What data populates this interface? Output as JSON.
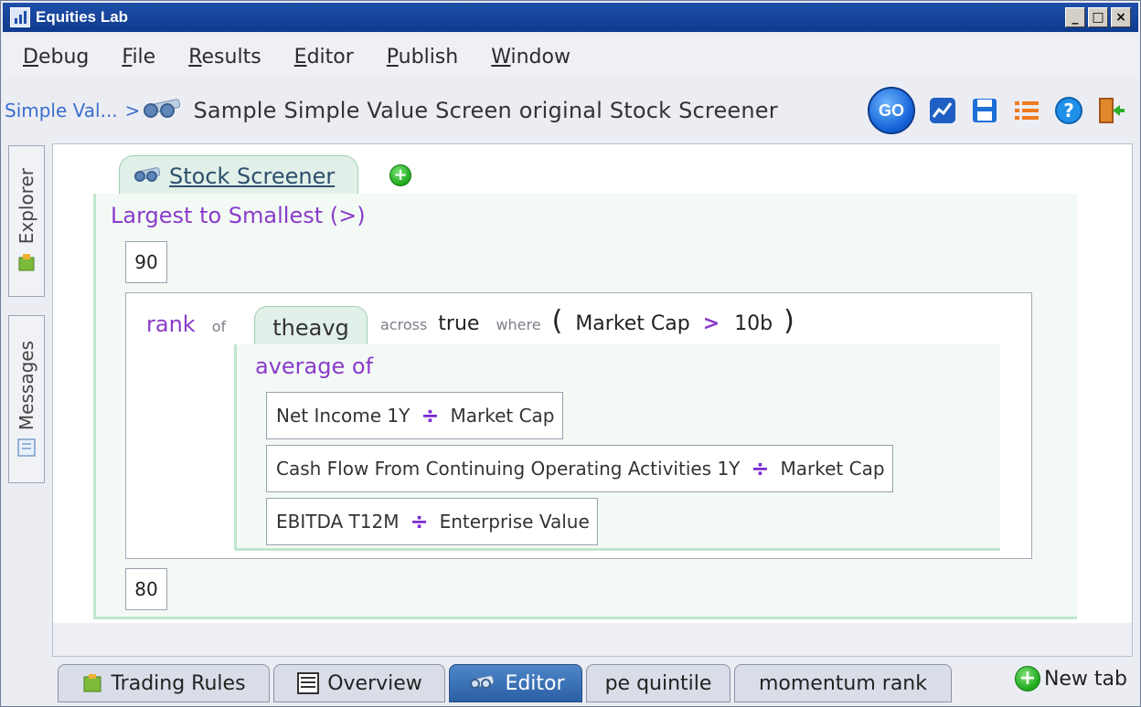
{
  "window": {
    "title": "Equities Lab"
  },
  "window_controls": {
    "minimize": "_",
    "maximize": "□",
    "close": "×"
  },
  "menu": [
    {
      "mnemonic": "D",
      "rest": "ebug"
    },
    {
      "mnemonic": "F",
      "rest": "ile"
    },
    {
      "mnemonic": "R",
      "rest": "esults"
    },
    {
      "mnemonic": "E",
      "rest": "ditor"
    },
    {
      "mnemonic": "P",
      "rest": "ublish"
    },
    {
      "mnemonic": "W",
      "rest": "indow"
    }
  ],
  "breadcrumb": {
    "parent": "Simple Val...",
    "separator": ">",
    "current": "Sample Simple Value Screen original Stock Screener"
  },
  "toolbar": {
    "go_label": "GO",
    "icons": [
      "chart-icon",
      "save-icon",
      "list-icon",
      "help-icon",
      "exit-icon"
    ]
  },
  "dock": {
    "explorer": "Explorer",
    "messages": "Messages"
  },
  "editor": {
    "tab_label": "Stock Screener",
    "heading": "Largest to Smallest (>)",
    "upper_value": "90",
    "lower_value": "80",
    "rank": {
      "keyword": "rank",
      "of": "of",
      "variable": "theavg",
      "across": "across",
      "across_value": "true",
      "where": "where",
      "open_paren": "(",
      "close_paren": ")",
      "condition_field": "Market Cap",
      "condition_op": ">",
      "condition_value": "10b"
    },
    "average": {
      "heading": "average of",
      "op": "÷",
      "formulas": [
        {
          "left": "Net Income 1Y",
          "right": "Market Cap"
        },
        {
          "left": "Cash Flow From Continuing Operating Activities 1Y",
          "right": "Market Cap"
        },
        {
          "left": "EBITDA T12M",
          "right": "Enterprise Value"
        }
      ]
    }
  },
  "bottom_tabs": [
    {
      "label": "Trading Rules",
      "active": false
    },
    {
      "label": "Overview",
      "active": false
    },
    {
      "label": "Editor",
      "active": true
    },
    {
      "label": "pe quintile",
      "active": false
    },
    {
      "label": "momentum rank",
      "active": false
    }
  ],
  "new_tab_label": "New tab",
  "colors": {
    "keyword": "#8a3bc9",
    "accent": "#2a5fa5",
    "go": "#1463d8",
    "add": "#1ea81a"
  }
}
